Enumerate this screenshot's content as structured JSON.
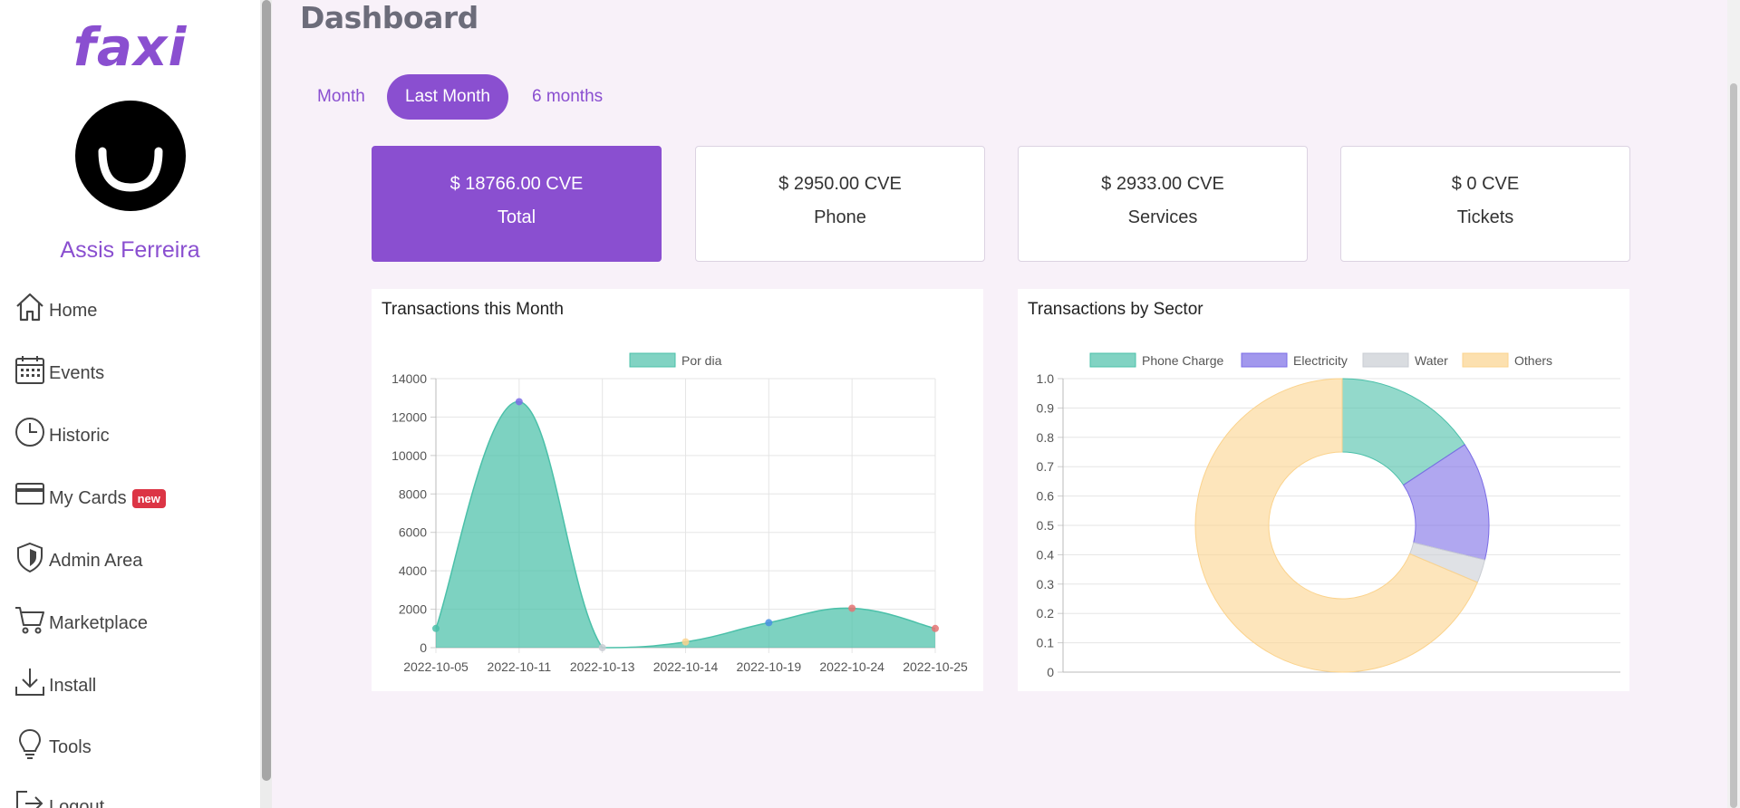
{
  "sidebar": {
    "logo": "faxi",
    "username": "Assis Ferreira",
    "items": [
      {
        "label": "Home",
        "icon": "home-icon"
      },
      {
        "label": "Events",
        "icon": "calendar-icon"
      },
      {
        "label": "Historic",
        "icon": "clock-icon"
      },
      {
        "label": "My Cards",
        "icon": "credit-card-icon",
        "badge": "new"
      },
      {
        "label": "Admin Area",
        "icon": "shield-icon"
      },
      {
        "label": "Marketplace",
        "icon": "cart-icon"
      },
      {
        "label": "Install",
        "icon": "download-icon"
      },
      {
        "label": "Tools",
        "icon": "lightbulb-icon"
      },
      {
        "label": "Logout",
        "icon": "logout-icon"
      }
    ]
  },
  "main": {
    "title": "Dashboard",
    "tabs": [
      {
        "label": "Month",
        "active": false
      },
      {
        "label": "Last Month",
        "active": true
      },
      {
        "label": "6 months",
        "active": false
      }
    ],
    "stats": [
      {
        "value": "$ 18766.00 CVE",
        "label": "Total",
        "active": true
      },
      {
        "value": "$ 2950.00 CVE",
        "label": "Phone",
        "active": false
      },
      {
        "value": "$ 2933.00 CVE",
        "label": "Services",
        "active": false
      },
      {
        "value": "$ 0 CVE",
        "label": "Tickets",
        "active": false
      }
    ],
    "panels": [
      {
        "title": "Transactions this Month"
      },
      {
        "title": "Transactions by Sector"
      }
    ]
  },
  "colors": {
    "accent": "#8a4fd0",
    "badge": "#dc3545",
    "background": "#f8f1f9",
    "teal": "#4bc0a9",
    "purple": "#7b6ce6",
    "grey": "#c9cdd3",
    "orange": "#fbd38d"
  },
  "chart_data": [
    {
      "type": "area",
      "title": "Transactions this Month",
      "x": [
        "2022-10-05",
        "2022-10-11",
        "2022-10-13",
        "2022-10-14",
        "2022-10-19",
        "2022-10-24",
        "2022-10-25"
      ],
      "series": [
        {
          "name": "Por dia",
          "values": [
            1000,
            12800,
            0,
            300,
            1300,
            2050,
            1000
          ]
        }
      ],
      "ylim": [
        0,
        14000
      ],
      "yticks": [
        0,
        2000,
        4000,
        6000,
        8000,
        10000,
        12000,
        14000
      ],
      "point_colors": [
        "#4bc0a9",
        "#7b6ce6",
        "#c9cdd3",
        "#fbd38d",
        "#4a90e2",
        "#e57373",
        "#e57373"
      ],
      "grid": true,
      "legend": "top"
    },
    {
      "type": "pie",
      "title": "Transactions by Sector",
      "categories": [
        "Phone Charge",
        "Electricity",
        "Water",
        "Others"
      ],
      "values": [
        2950,
        2450,
        483,
        12883
      ],
      "colors": [
        "#4bc0a9",
        "#7b6ce6",
        "#c9cdd3",
        "#fbd38d"
      ],
      "yticks": [
        "0",
        "0.1",
        "0.2",
        "0.3",
        "0.4",
        "0.5",
        "0.6",
        "0.7",
        "0.8",
        "0.9",
        "1.0"
      ],
      "grid": true,
      "legend": "top"
    }
  ]
}
